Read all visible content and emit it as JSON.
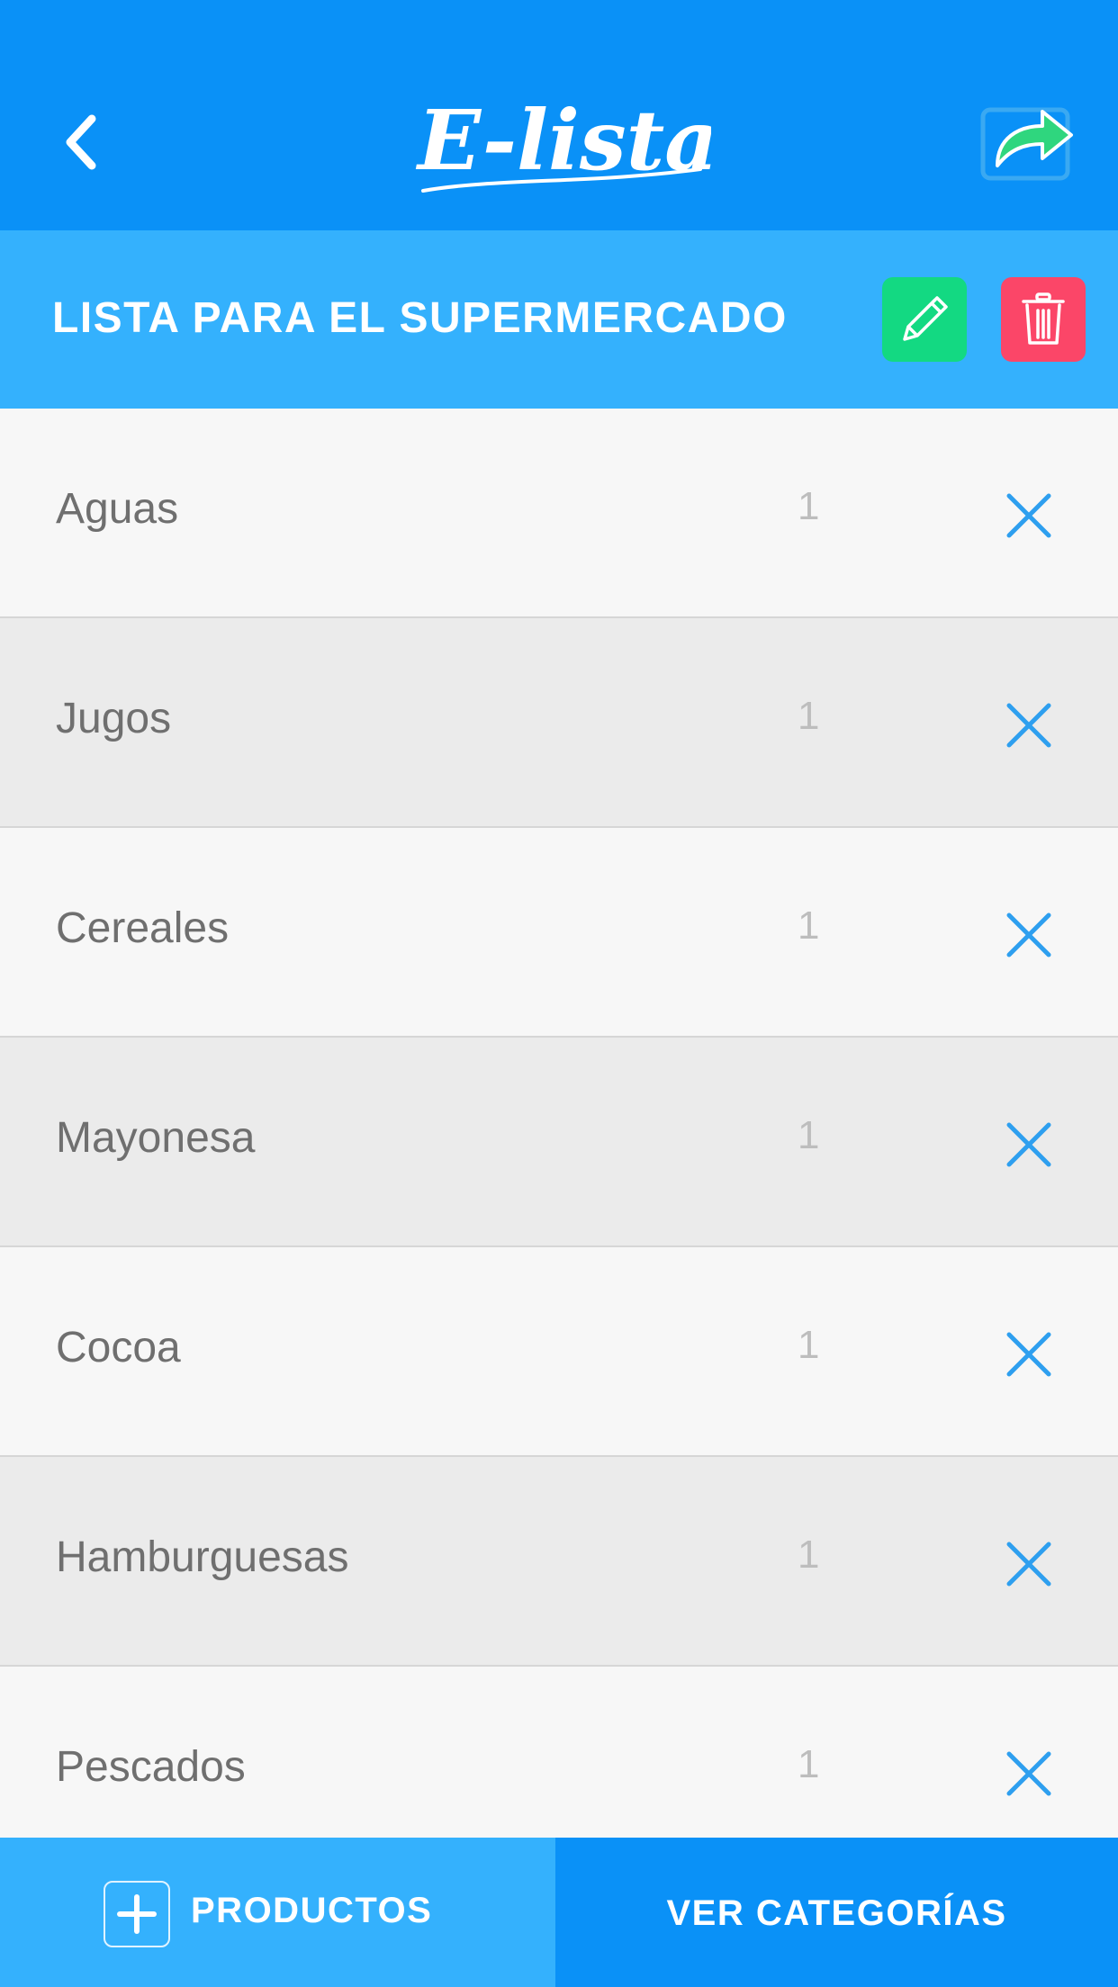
{
  "header": {
    "logo_text": "E-lista"
  },
  "list": {
    "title": "LISTA PARA EL SUPERMERCADO",
    "items": [
      {
        "name": "Aguas",
        "quantity": "1"
      },
      {
        "name": "Jugos",
        "quantity": "1"
      },
      {
        "name": "Cereales",
        "quantity": "1"
      },
      {
        "name": "Mayonesa",
        "quantity": "1"
      },
      {
        "name": "Cocoa",
        "quantity": "1"
      },
      {
        "name": "Hamburguesas",
        "quantity": "1"
      },
      {
        "name": "Pescados",
        "quantity": "1"
      }
    ]
  },
  "footer": {
    "products_label": "PRODUCTOS",
    "categories_label": "VER CATEGORÍAS"
  },
  "colors": {
    "header_bg": "#0a91f7",
    "title_bar_bg": "#34b1fd",
    "edit_button": "#13d982",
    "delete_button": "#fb4668",
    "remove_icon": "#2e9fef",
    "share_arrow": "#2fd67e"
  },
  "icons": {
    "back": "chevron-left-icon",
    "share": "share-icon",
    "edit": "pencil-icon",
    "delete": "trash-icon",
    "remove": "close-icon",
    "add": "plus-icon"
  }
}
